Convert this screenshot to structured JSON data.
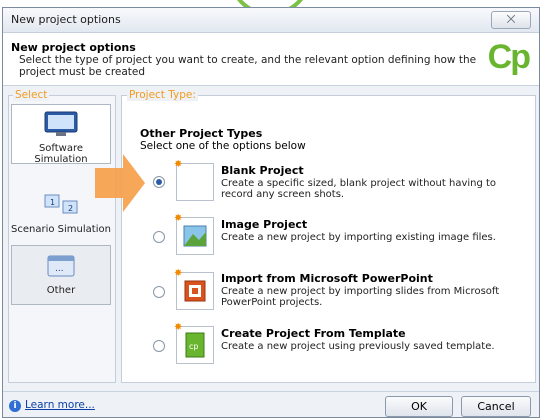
{
  "window": {
    "title": "New project options",
    "close_glyph": "⨉"
  },
  "header": {
    "title": "New project options",
    "description": "Select the type of project you want to create, and the relevant option defining how the project must be created",
    "logo": "Cp"
  },
  "select_panel": {
    "legend": "Select",
    "items": [
      {
        "label": "Software Simulation",
        "icon": "monitor-icon",
        "selected": true
      },
      {
        "label": "Scenario Simulation",
        "icon": "scenario-icon",
        "selected": false
      },
      {
        "label": "Other",
        "icon": "other-icon",
        "selected": false
      }
    ]
  },
  "project_type": {
    "legend": "Project Type:",
    "heading": "Other Project Types",
    "subheading": "Select one of the options below",
    "options": [
      {
        "name": "Blank Project",
        "description": "Create a specific sized, blank project without having to record any screen shots.",
        "selected": true,
        "icon": "blank-project-icon"
      },
      {
        "name": "Image Project",
        "description": "Create a new project by importing existing image files.",
        "selected": false,
        "icon": "image-project-icon"
      },
      {
        "name": "Import from Microsoft PowerPoint",
        "description": "Create a new project by importing slides from Microsoft PowerPoint projects.",
        "selected": false,
        "icon": "powerpoint-icon"
      },
      {
        "name": "Create Project From Template",
        "description": "Create a new project using previously saved template.",
        "selected": false,
        "icon": "template-icon"
      }
    ]
  },
  "footer": {
    "learn_more": "Learn more...",
    "ok": "OK",
    "cancel": "Cancel"
  },
  "colors": {
    "accent": "#f29a1e",
    "brand": "#6ab530",
    "arrow": "#f5a04a",
    "link": "#0b3fa8"
  }
}
